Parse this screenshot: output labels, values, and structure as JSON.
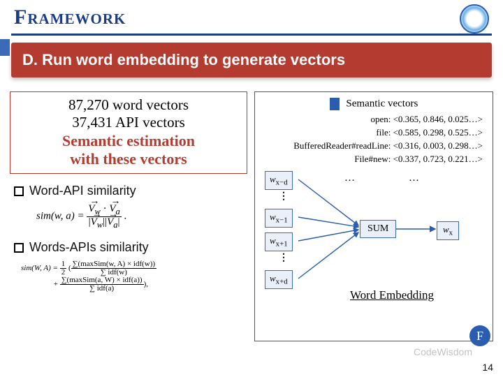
{
  "header": {
    "title": "Framework"
  },
  "banner": {
    "text": "D. Run word embedding to generate vectors"
  },
  "stats": {
    "line1": "87,270 word vectors",
    "line2": "37,431 API vectors",
    "line3a": "Semantic estimation",
    "line3b": "with these vectors"
  },
  "bullets": {
    "b1": "Word-API similarity",
    "b2": "Words-APIs similarity"
  },
  "formula1": {
    "lhs": "sim(w, a) =",
    "num": "V_w · V_a",
    "den": "|V_w||V_a|",
    "tail": "."
  },
  "formula2": {
    "lhs": "sim(W, A) =",
    "half": "1/2",
    "t1n": "∑(maxSim(w, A) × idf(w))",
    "t1d": "∑ idf(w)",
    "plus": "+",
    "t2n": "∑(maxSim(a, W) × idf(a))",
    "t2d": "∑ idf(a)",
    "tail": "),"
  },
  "diagram": {
    "sv_title": "Semantic vectors",
    "lines": {
      "l1": "open:  <0.365, 0.846, 0.025…>",
      "l2": "file:  <0.585, 0.298, 0.525…>",
      "l3": "BufferedReader#readLine:  <0.316, 0.003, 0.298…>",
      "l4": "File#new:  <0.337, 0.723, 0.221…>"
    },
    "boxes": {
      "w1": "w",
      "w1sub": "x−d",
      "w2": "w",
      "w2sub": "x−1",
      "w3": "w",
      "w3sub": "x+1",
      "w4": "w",
      "w4sub": "x+d",
      "sum": "SUM",
      "out": "w",
      "outsub": "x"
    },
    "hdots1": "…",
    "hdots2": "…",
    "label": "Word Embedding"
  },
  "footer": {
    "watermark": "CodeWisdom",
    "fbadge": "F",
    "pagenum": "14"
  }
}
